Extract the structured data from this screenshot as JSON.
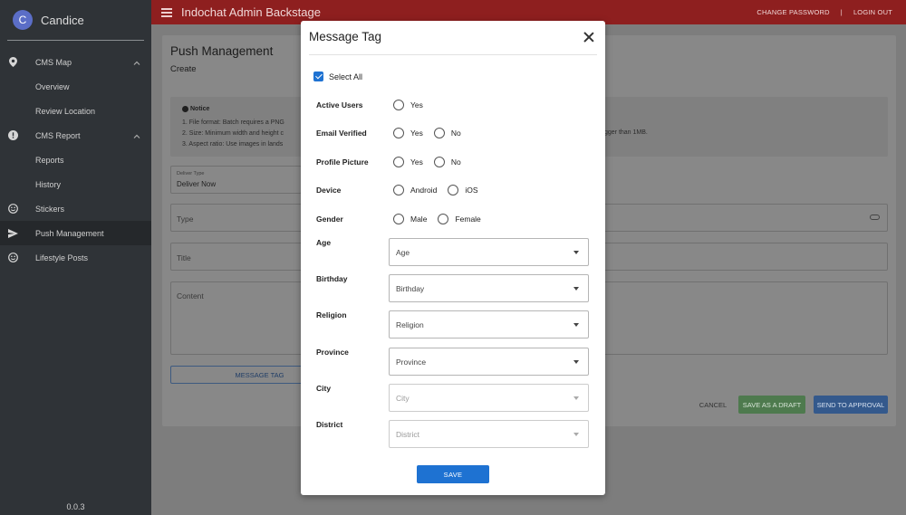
{
  "sidebar": {
    "avatar_letter": "C",
    "username": "Candice",
    "items": [
      {
        "label": "CMS Map",
        "icon": "map-pin-icon",
        "expanded": true
      },
      {
        "label": "Overview"
      },
      {
        "label": "Review Location"
      },
      {
        "label": "CMS Report",
        "icon": "alert-circle-icon",
        "expanded": true
      },
      {
        "label": "Reports"
      },
      {
        "label": "History"
      },
      {
        "label": "Stickers",
        "icon": "smiley-icon"
      },
      {
        "label": "Push Management",
        "icon": "send-icon",
        "active": true
      },
      {
        "label": "Lifestyle Posts",
        "icon": "smiley-icon"
      }
    ],
    "version": "0.0.3"
  },
  "header": {
    "title": "Indochat Admin Backstage",
    "change_password": "CHANGE PASSWORD",
    "separator": "|",
    "logout": "LOGIN OUT",
    "color": "#b82a2a"
  },
  "main": {
    "title": "Push Management",
    "subtitle": "Create",
    "notice": {
      "title": "Notice",
      "lines": [
        "1. File format: Batch requires a PNG",
        "2. Size: Minimum width and height c",
        "3. Aspect ratio: Use images in lands"
      ],
      "tail": "gger than 1MB."
    },
    "deliver_type": {
      "label": "Deliver Type",
      "value": "Deliver Now"
    },
    "type_label": "Type",
    "title_label": "Title",
    "content_label": "Content",
    "message_tag_button": "MESSAGE TAG",
    "cancel": "CANCEL",
    "save_draft": "SAVE AS A DRAFT",
    "send_approval": "SEND TO APPROVAL"
  },
  "modal": {
    "title": "Message Tag",
    "select_all": "Select All",
    "select_all_checked": true,
    "radio_rows": [
      {
        "label": "Active Users",
        "options": [
          "Yes"
        ]
      },
      {
        "label": "Email Verified",
        "options": [
          "Yes",
          "No"
        ]
      },
      {
        "label": "Profile Picture",
        "options": [
          "Yes",
          "No"
        ]
      },
      {
        "label": "Device",
        "options": [
          "Android",
          "iOS"
        ]
      },
      {
        "label": "Gender",
        "options": [
          "Male",
          "Female"
        ]
      }
    ],
    "selects": [
      {
        "label": "Age",
        "placeholder": "Age",
        "disabled": false
      },
      {
        "label": "Birthday",
        "placeholder": "Birthday",
        "disabled": false
      },
      {
        "label": "Religion",
        "placeholder": "Religion",
        "disabled": false
      },
      {
        "label": "Province",
        "placeholder": "Province",
        "disabled": false
      },
      {
        "label": "City",
        "placeholder": "City",
        "disabled": true
      },
      {
        "label": "District",
        "placeholder": "District",
        "disabled": true
      }
    ],
    "save": "SAVE",
    "accent": "#1e72d2"
  }
}
